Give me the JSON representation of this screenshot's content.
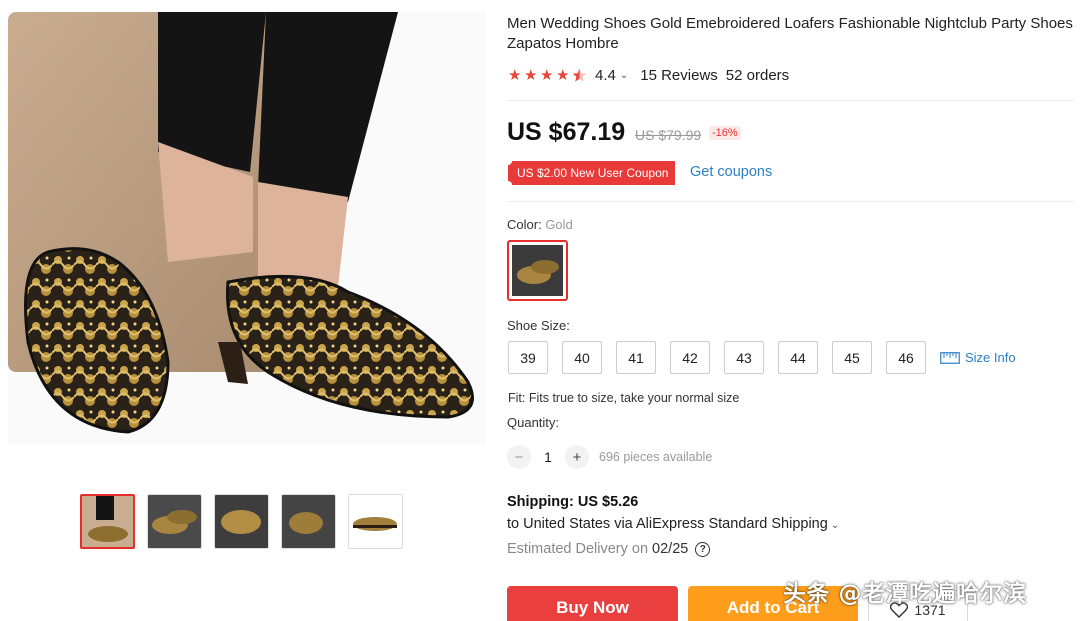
{
  "product": {
    "title": "Men Wedding Shoes Gold Emebroidered Loafers Fashionable Nightclub Party Shoes Zapatos Hombre",
    "rating": "4.4",
    "reviews": "15 Reviews",
    "orders": "52 orders",
    "star_color": "#e8453c",
    "star_count": 4.5
  },
  "price": {
    "current": "US $67.19",
    "original": "US $79.99",
    "discount": "-16%"
  },
  "coupon": {
    "label": "US $2.00 New User Coupon",
    "link": "Get coupons"
  },
  "color": {
    "label": "Color:",
    "selected": "Gold"
  },
  "size": {
    "label": "Shoe Size:",
    "options": [
      "39",
      "40",
      "41",
      "42",
      "43",
      "44",
      "45",
      "46"
    ],
    "info_label": "Size Info",
    "info_icon": "ruler-icon"
  },
  "fit": "Fit: Fits true to size, take your normal size",
  "quantity": {
    "label": "Quantity:",
    "value": "1",
    "minus": "−",
    "plus": "+",
    "available": "696 pieces available"
  },
  "shipping": {
    "title": "Shipping: US $5.26",
    "route": "to United States via AliExpress Standard Shipping",
    "estimated_label": "Estimated Delivery on",
    "date": "02/25",
    "help_icon": "question-circle-icon"
  },
  "actions": {
    "buy_now": "Buy Now",
    "add_to_cart": "Add to Cart",
    "wishlist_count": "1371",
    "wishlist_icon": "heart-icon"
  },
  "watermark": "头条 @老潭吃遍哈尔滨",
  "colors": {
    "accent_red": "#e62e2e",
    "buy_now": "#e9403f",
    "add_to_cart": "#ff9e1b",
    "link_blue": "#2b7fc4"
  }
}
